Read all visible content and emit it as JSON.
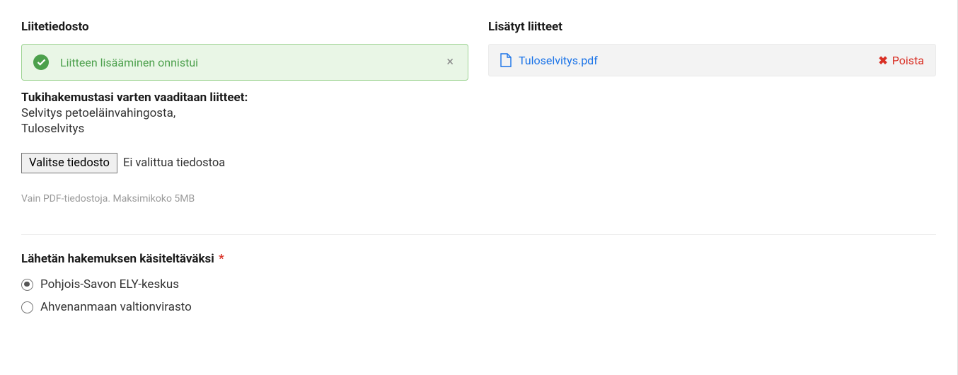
{
  "leftColumn": {
    "heading": "Liitetiedosto",
    "successAlert": {
      "message": "Liitteen lisääminen onnistui"
    },
    "requirements": {
      "label": "Tukihakemustasi varten vaaditaan liitteet:",
      "line1": "Selvitys petoeläinvahingosta,",
      "line2": "Tuloselvitys"
    },
    "filePicker": {
      "buttonLabel": "Valitse tiedosto",
      "statusText": "Ei valittua tiedostoa"
    },
    "hint": "Vain PDF-tiedostoja. Maksimikoko 5MB"
  },
  "rightColumn": {
    "heading": "Lisätyt liitteet",
    "attachment": {
      "fileName": "Tuloselvitys.pdf",
      "removeLabel": "Poista"
    }
  },
  "destination": {
    "label": "Lähetän hakemuksen käsiteltäväksi",
    "requiredMark": "*",
    "option1": "Pohjois-Savon ELY-keskus",
    "option2": "Ahvenanmaan valtionvirasto"
  }
}
